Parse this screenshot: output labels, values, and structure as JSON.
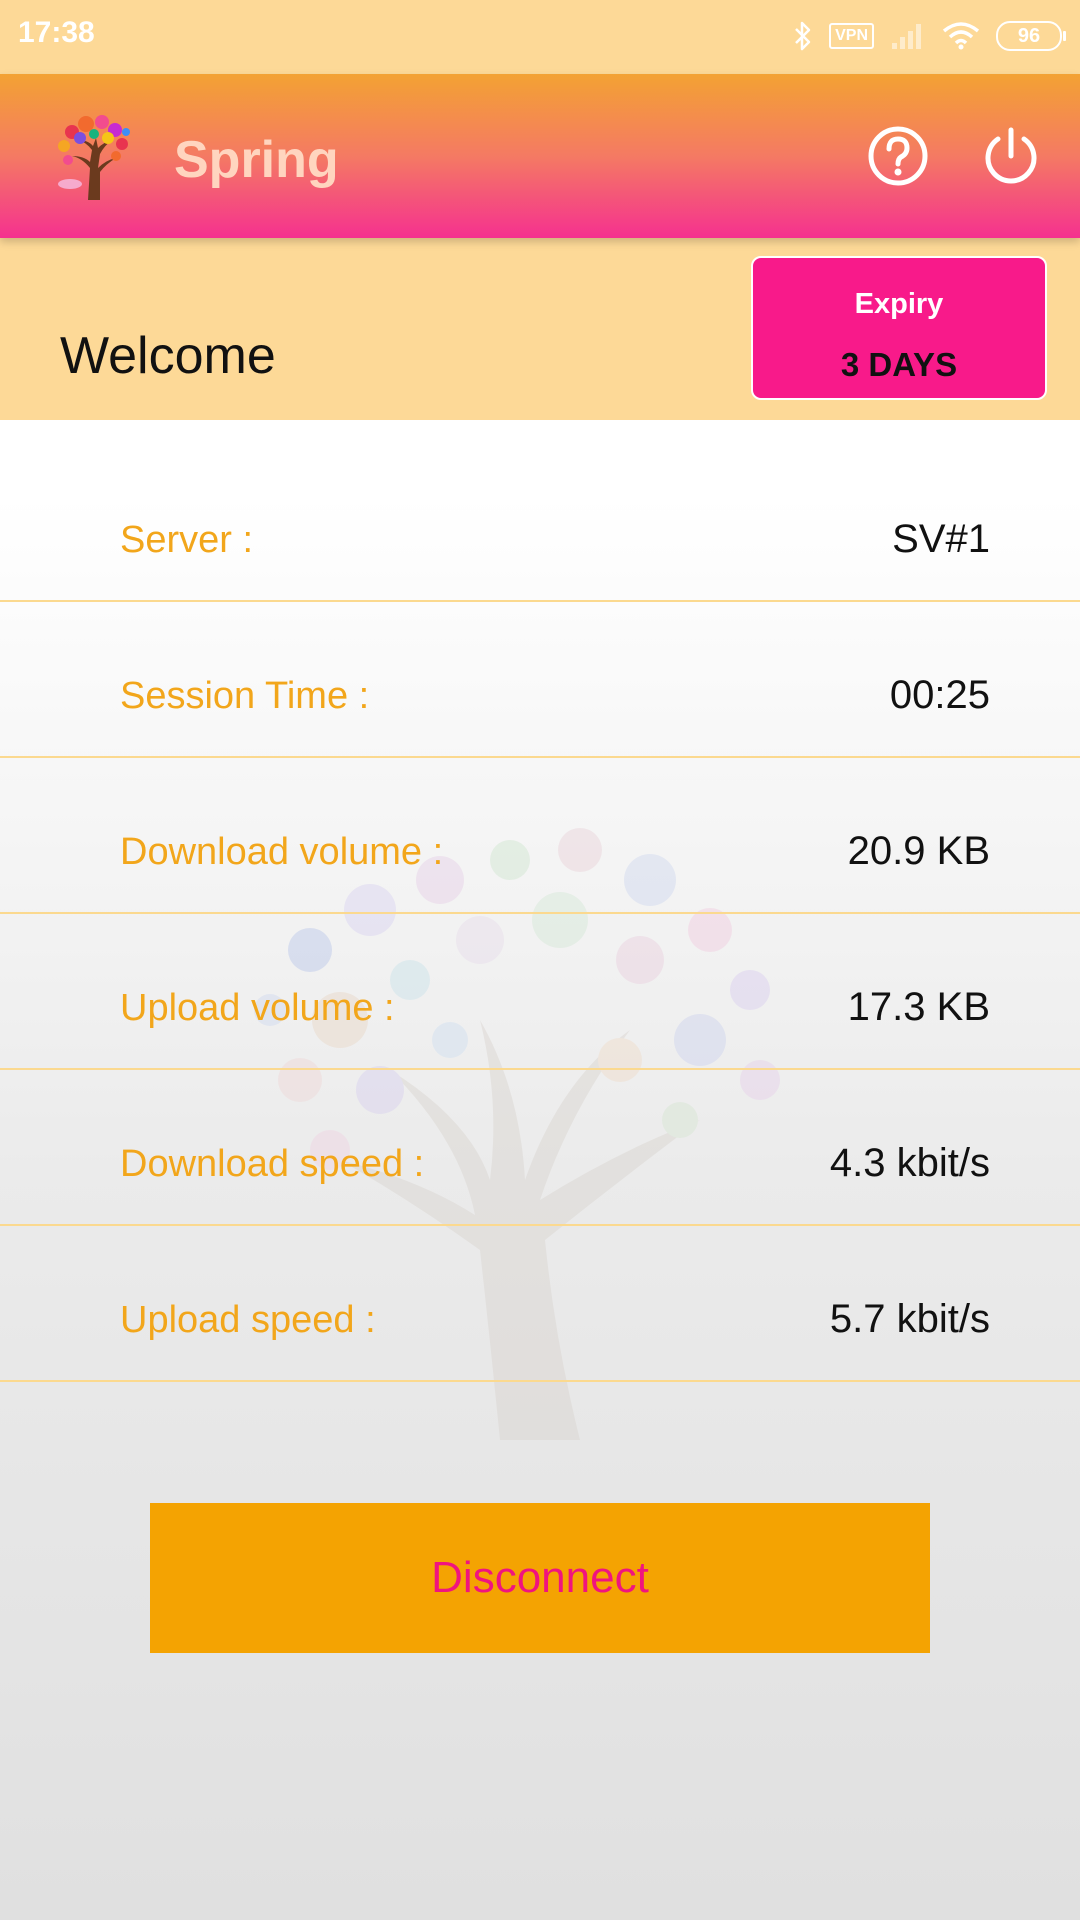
{
  "status_bar": {
    "time": "17:38",
    "vpn_label": "VPN",
    "battery_level": "96",
    "icons": [
      "bluetooth-icon",
      "vpn-icon",
      "signal-icon",
      "wifi-icon",
      "battery-icon"
    ]
  },
  "app_bar": {
    "title": "Spring",
    "logo": "spring-tree-logo",
    "actions": [
      "help-icon",
      "power-icon"
    ]
  },
  "welcome": {
    "greeting": "Welcome",
    "expiry_label": "Expiry",
    "expiry_value": "3 DAYS"
  },
  "stats": [
    {
      "label": "Server :",
      "value": "SV#1"
    },
    {
      "label": "Session Time :",
      "value": "00:25"
    },
    {
      "label": "Download volume :",
      "value": "20.9 KB"
    },
    {
      "label": "Upload volume :",
      "value": "17.3 KB"
    },
    {
      "label": "Download speed :",
      "value": "4.3 kbit/s"
    },
    {
      "label": "Upload speed :",
      "value": "5.7 kbit/s"
    }
  ],
  "actions": {
    "disconnect_label": "Disconnect"
  },
  "colors": {
    "header_gradient_top": "#f3a233",
    "header_gradient_bottom": "#f5318f",
    "accent_yellow": "#fdd997",
    "label_orange": "#f2a61b",
    "expiry_pink": "#f81a8a",
    "button_orange": "#f4a302",
    "button_text_pink": "#f0147f"
  }
}
